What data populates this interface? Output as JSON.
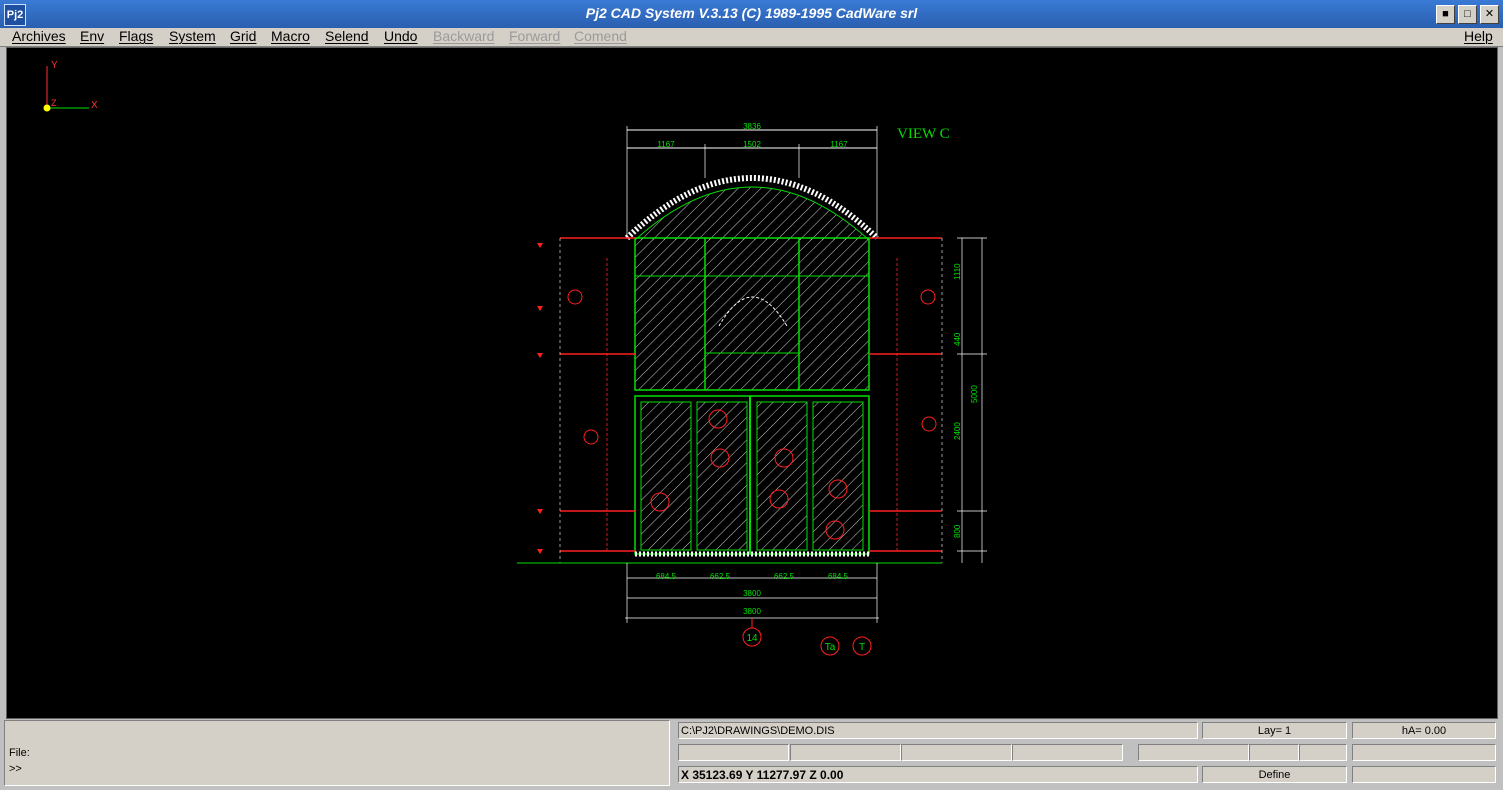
{
  "window": {
    "title": "Pj2 CAD System V.3.13  (C) 1989-1995 CadWare srl",
    "app_icon_text": "Pj2"
  },
  "menu": {
    "items": [
      {
        "label": "Archives",
        "enabled": true
      },
      {
        "label": "Env",
        "enabled": true
      },
      {
        "label": "Flags",
        "enabled": true
      },
      {
        "label": "System",
        "enabled": true
      },
      {
        "label": "Grid",
        "enabled": true
      },
      {
        "label": "Macro",
        "enabled": true
      },
      {
        "label": "Selend",
        "enabled": true
      },
      {
        "label": "Undo",
        "enabled": true
      },
      {
        "label": "Backward",
        "enabled": false
      },
      {
        "label": "Forward",
        "enabled": false
      },
      {
        "label": "Comend",
        "enabled": false
      }
    ],
    "help_label": "Help"
  },
  "axis": {
    "x_label": "X",
    "y_label": "Y",
    "z_label": "Z"
  },
  "drawing": {
    "view_label": "VIEW C",
    "dim_top_total": "3836",
    "dim_top_left": "1167",
    "dim_top_mid": "1502",
    "dim_top_right": "1167",
    "dim_bottom_1": "684.5",
    "dim_bottom_2": "662.5",
    "dim_bottom_3": "662.5",
    "dim_bottom_4": "684.5",
    "dim_bottom_inner": "3800",
    "dim_bottom_outer": "3800",
    "dim_right_total": "5000",
    "dim_right_a": "1110",
    "dim_right_b": "440",
    "dim_right_c": "2400",
    "dim_right_d": "800",
    "bubble_main": "14",
    "bubble_ta": "Ta",
    "bubble_t": "T"
  },
  "command": {
    "file_label": "File:",
    "prompt": ">>"
  },
  "status": {
    "filepath": "C:\\PJ2\\DRAWINGS\\DEMO.DIS",
    "layer": "Lay= 1",
    "ha": "hA= 0.00",
    "coords": "X 35123.69  Y 11277.97  Z 0.00",
    "mode": "Define"
  },
  "colors": {
    "drawing_green": "#00e000",
    "drawing_red": "#ff2020",
    "drawing_white": "#ffffff",
    "title_blue": "#2a5fb0"
  }
}
